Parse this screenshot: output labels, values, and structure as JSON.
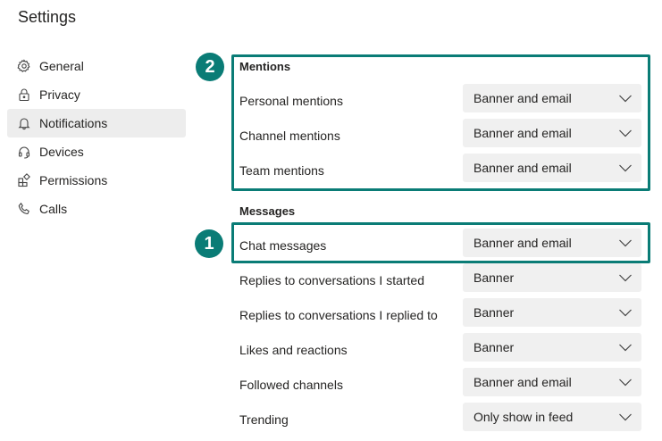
{
  "page": {
    "title": "Settings"
  },
  "sidebar": {
    "items": [
      {
        "label": "General",
        "icon": "gear-icon"
      },
      {
        "label": "Privacy",
        "icon": "lock-icon"
      },
      {
        "label": "Notifications",
        "icon": "bell-icon",
        "active": true
      },
      {
        "label": "Devices",
        "icon": "headset-icon"
      },
      {
        "label": "Permissions",
        "icon": "apps-icon"
      },
      {
        "label": "Calls",
        "icon": "phone-icon"
      }
    ]
  },
  "mentions": {
    "heading": "Mentions",
    "rows": [
      {
        "label": "Personal mentions",
        "value": "Banner and email"
      },
      {
        "label": "Channel mentions",
        "value": "Banner and email"
      },
      {
        "label": "Team mentions",
        "value": "Banner and email"
      }
    ]
  },
  "messages": {
    "heading": "Messages",
    "rows": [
      {
        "label": "Chat messages",
        "value": "Banner and email"
      },
      {
        "label": "Replies to conversations I started",
        "value": "Banner"
      },
      {
        "label": "Replies to conversations I replied to",
        "value": "Banner"
      },
      {
        "label": "Likes and reactions",
        "value": "Banner"
      },
      {
        "label": "Followed channels",
        "value": "Banner and email"
      },
      {
        "label": "Trending",
        "value": "Only show in feed"
      }
    ]
  },
  "callouts": {
    "badge_1": "1",
    "badge_2": "2"
  },
  "colors": {
    "accent": "#0a7c76",
    "dropdown_bg": "#f0f0f0",
    "active_nav_bg": "#ededed"
  }
}
